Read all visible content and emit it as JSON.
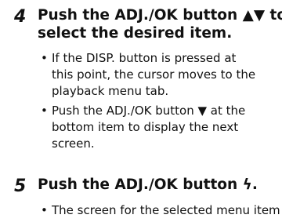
{
  "steps": [
    {
      "number": "4",
      "heading_line1": "Push the ADJ./OK button ▲▼ to",
      "heading_line2": "select the desired item.",
      "bullets": [
        {
          "dot": "•",
          "text": "If the DISP. button is pressed at\nthis point, the cursor moves to the\nplayback menu tab."
        },
        {
          "dot": "•",
          "text": "Push the ADJ./OK button ▼ at the\nbottom item to display the next\nscreen."
        }
      ]
    },
    {
      "number": "5",
      "heading_line1": "Push the ADJ./OK button ϟ.",
      "bullets": [
        {
          "dot": "•",
          "text": "The screen for the selected menu item"
        }
      ]
    }
  ]
}
